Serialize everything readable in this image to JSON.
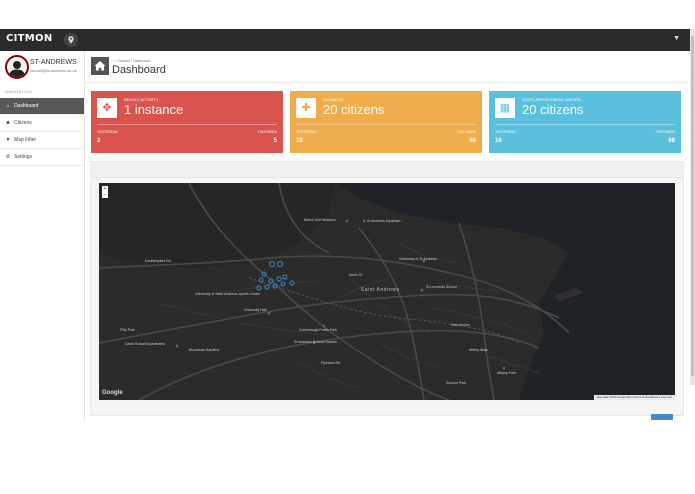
{
  "app": {
    "logo": "CITMON"
  },
  "user": {
    "name": "ST-ANDREWS",
    "email": "council@st-andrews.ac.uk"
  },
  "sidebar": {
    "heading": "NAVIGATION",
    "items": [
      {
        "label": "Dashboard",
        "icon": "home-icon",
        "glyph": "⌂"
      },
      {
        "label": "Citizens",
        "icon": "users-icon",
        "glyph": "☻"
      },
      {
        "label": "Map Filter",
        "icon": "filter-icon",
        "glyph": "▼"
      },
      {
        "label": "Settings",
        "icon": "gear-icon",
        "glyph": "⚙"
      }
    ]
  },
  "header": {
    "breadcrumb": {
      "sep": "/",
      "level1": "Dictator",
      "level2": "Dashboard"
    },
    "title": "Dashboard"
  },
  "cards": [
    {
      "label": "REVOLT ACTIVITY",
      "value": "1 instance",
      "yesterday_label": "YESTERDAY",
      "yesterday": "2",
      "week_label": "THIS WEEK",
      "week": "5",
      "color": "#d9534f",
      "icon": "move-arrows-icon",
      "glyph": "✥"
    },
    {
      "label": "SICKNESS",
      "value": "20 citizens",
      "yesterday_label": "YESTERDAY",
      "yesterday": "18",
      "week_label": "THIS WEEK",
      "week": "68",
      "color": "#f0ad4e",
      "icon": "medkit-icon",
      "glyph": "✚"
    },
    {
      "label": "STATE APPOINTMENT MISSED",
      "value": "20 citizens",
      "yesterday_label": "YESTERDAY",
      "yesterday": "18",
      "week_label": "THIS WEEK",
      "week": "68",
      "color": "#5bc0de",
      "icon": "calendar-icon",
      "glyph": "▦"
    }
  ],
  "map": {
    "zoom_in": "+",
    "zoom_out": "−",
    "google": "Google",
    "attribution": "Map data ©2013 Google   200 m   Terms of Use   Report a map error",
    "labels": {
      "golf_museum": "British Golf Museum",
      "aquarium": "St Andrews Aquarium",
      "university": "University of St Andrews",
      "st_andrews": "Saint Andrews",
      "leonards": "St Leonards School",
      "sports_centre": "University of Saint Andrews Sports Centre",
      "univ_hall": "University Hall",
      "fifty_park": "Fifty Park",
      "cockshaugh": "Cockshaugh Public Park",
      "botanic": "St Andrews Botanic Garden",
      "david_russell": "David Russell Apartments",
      "buchanan": "Buchanan Gardens",
      "albany": "Albany Park",
      "doubledykes": "Doubledykes Rd",
      "pipeland": "Pipeland Rd",
      "east_scores": "East Scores",
      "kinburn": "Kinburn Park",
      "north_st": "North St",
      "abbey_walk": "Abbey Walk"
    }
  }
}
